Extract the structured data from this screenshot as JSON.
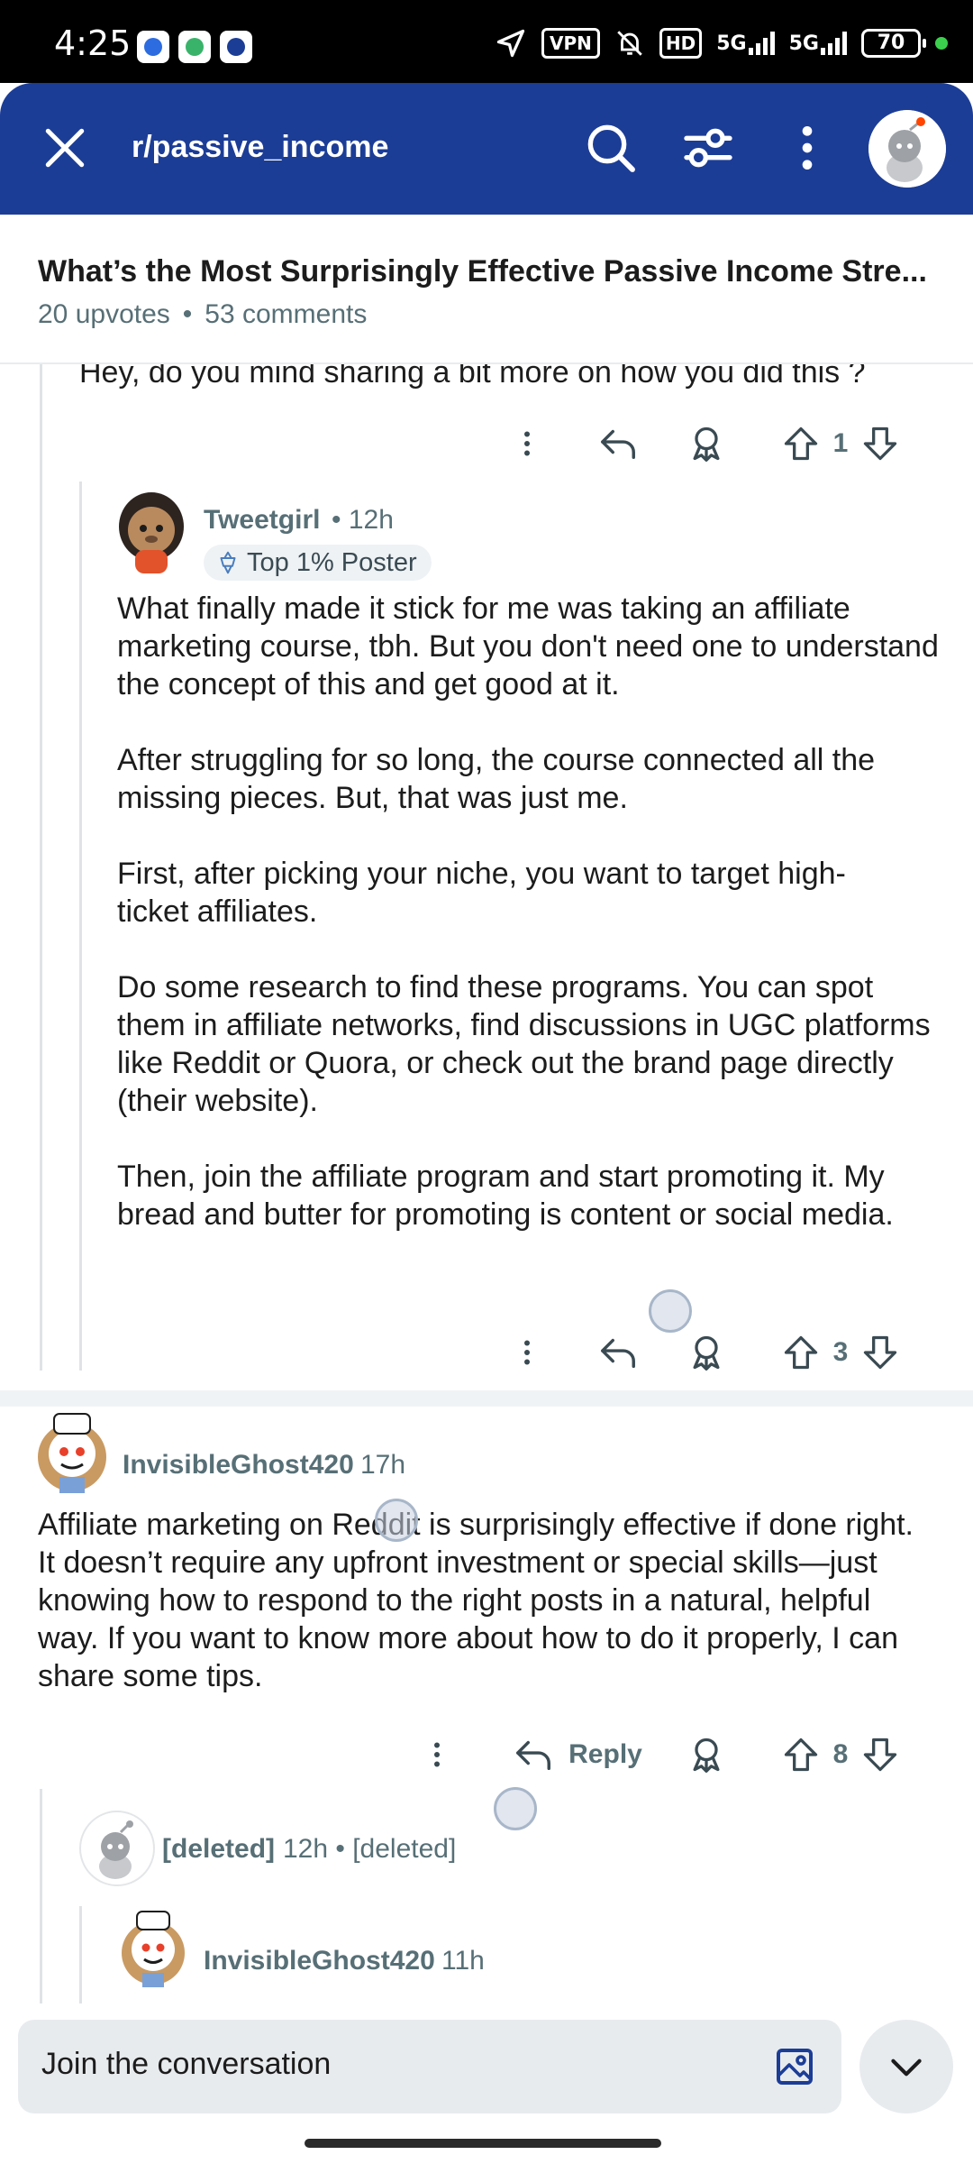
{
  "status_bar": {
    "time": "4:25",
    "vpn": "VPN",
    "hd": "HD",
    "network": "5G",
    "network2": "5G",
    "battery": "70"
  },
  "header": {
    "subreddit": "r/passive_income",
    "close_icon": "close-icon",
    "search_icon": "search-icon",
    "filter_icon": "sort-filter-icon",
    "more_icon": "more-vertical-icon",
    "accent": "#1c3d96"
  },
  "post": {
    "title": "What’s the Most Surprisingly Effective Passive Income Stre...",
    "upvotes": "20 upvotes",
    "separator": "•",
    "comments": "53 comments"
  },
  "comments": [
    {
      "id": "partial",
      "text": "Hey, do you mind sharing a bit more on how you did this ?",
      "votes": "1"
    },
    {
      "id": "tweetgirl",
      "author": "Tweetgirl",
      "time": "• 12h",
      "flair": "Top 1% Poster",
      "paragraphs": [
        "What finally made it stick for me was taking an affiliate marketing course, tbh. But you don't need one to understand the concept of this and get good at it.",
        "After struggling for so long, the course connected all the missing pieces. But, that was just me.",
        "First, after picking your niche, you want to target high-ticket affiliates.",
        "Do some research to find these programs. You can spot them in affiliate networks, find discussions in UGC platforms like Reddit or Quora, or check out the brand page directly (their website).",
        "Then, join the affiliate program and start promoting it. My bread and butter for promoting is content or social media."
      ],
      "votes": "3"
    },
    {
      "id": "ghost-top",
      "author": "InvisibleGhost420",
      "time": "17h",
      "text": "Affiliate marketing on Reddit is surprisingly effective if done right. It doesn’t require any upfront investment or special skills—just knowing how to respond to the right posts in a natural, helpful way. If you want to know more about how to do it properly, I can share some tips.",
      "reply_label": "Reply",
      "votes": "8"
    },
    {
      "id": "deleted",
      "author": "[deleted]",
      "time": "12h • [deleted]"
    },
    {
      "id": "ghost-reply",
      "author": "InvisibleGhost420",
      "time": "11h"
    }
  ],
  "composer": {
    "placeholder": "Join the conversation",
    "image_icon": "image-icon",
    "collapse_icon": "chevron-down-icon"
  }
}
